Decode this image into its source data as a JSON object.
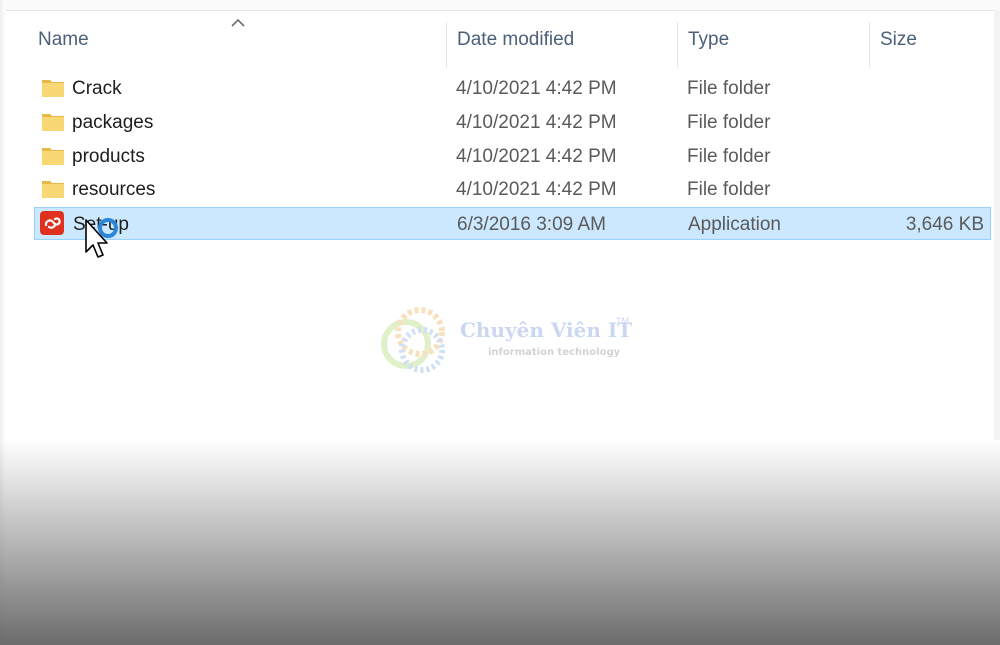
{
  "columns": {
    "name": "Name",
    "date_modified": "Date modified",
    "type": "Type",
    "size": "Size"
  },
  "sort": {
    "column": "name",
    "direction": "ascending",
    "icon": "chevron-up-icon"
  },
  "files": [
    {
      "name": "Crack",
      "date": "4/10/2021 4:42 PM",
      "type": "File folder",
      "size": "",
      "icon": "folder-icon",
      "selected": false
    },
    {
      "name": "packages",
      "date": "4/10/2021 4:42 PM",
      "type": "File folder",
      "size": "",
      "icon": "folder-icon",
      "selected": false
    },
    {
      "name": "products",
      "date": "4/10/2021 4:42 PM",
      "type": "File folder",
      "size": "",
      "icon": "folder-icon",
      "selected": false
    },
    {
      "name": "resources",
      "date": "4/10/2021 4:42 PM",
      "type": "File folder",
      "size": "",
      "icon": "folder-icon",
      "selected": false
    },
    {
      "name": "Set-up",
      "date": "6/3/2016 3:09 AM",
      "type": "Application",
      "size": "3,646 KB",
      "icon": "adobe-cc-app-icon",
      "selected": true
    }
  ],
  "watermark": {
    "title": "Chuyên Viên IT",
    "trademark": "TM",
    "subtitle": "information technology"
  },
  "colors": {
    "selection_fill": "#cce8ff",
    "selection_border": "#99d1ff",
    "folder": "#f8d775",
    "app_icon": "#e0301e",
    "header_text": "#4c607a"
  }
}
